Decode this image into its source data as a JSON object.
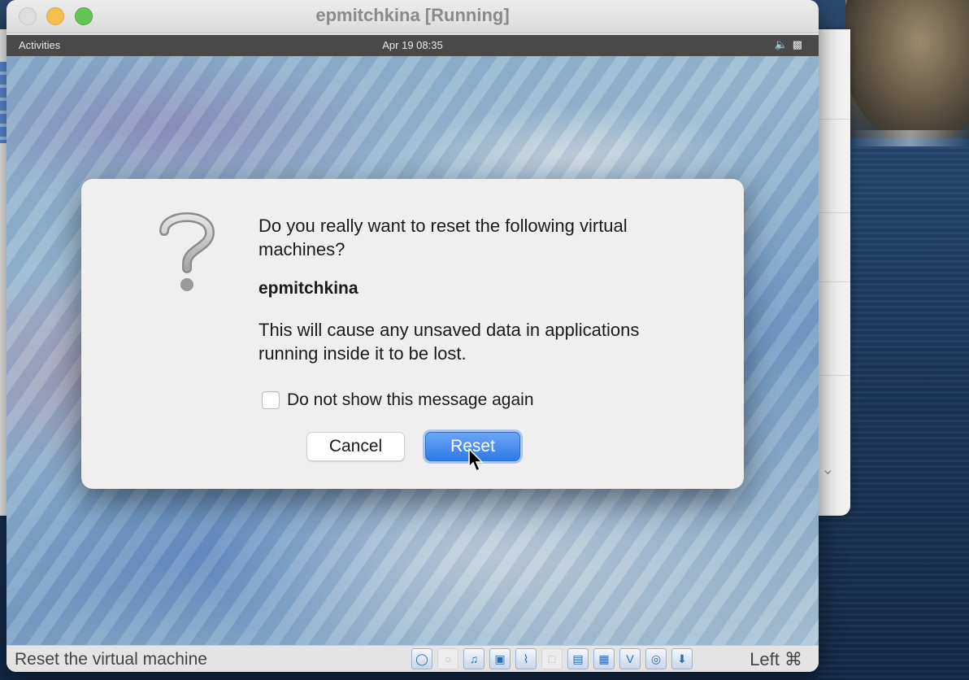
{
  "window": {
    "title": "epmitchkina [Running]"
  },
  "guest_topbar": {
    "activities": "Activities",
    "clock": "Apr 19  08:35",
    "tray_icons": [
      "volume-icon",
      "battery-icon"
    ]
  },
  "dialog": {
    "question": "Do you really want to reset the following virtual machines?",
    "vm_name": "epmitchkina",
    "warning": "This will cause any unsaved data in applications running inside it to be lost.",
    "checkbox_label": "Do not show this message again",
    "checkbox_checked": false,
    "cancel_label": "Cancel",
    "reset_label": "Reset",
    "icon": "question-mark-icon"
  },
  "statusbar": {
    "message": "Reset the virtual machine",
    "host_key": "Left ⌘",
    "icons": [
      "optical-disk-icon",
      "floppy-icon",
      "audio-icon",
      "network-icon",
      "usb-icon",
      "shared-folder-icon",
      "display-icon",
      "capture-icon",
      "recording-icon",
      "mouse-integration-icon",
      "keyboard-capture-icon"
    ]
  },
  "colors": {
    "accent": "#2f7ae6",
    "traffic_min": "#f4bf4f",
    "traffic_max": "#62c554"
  }
}
